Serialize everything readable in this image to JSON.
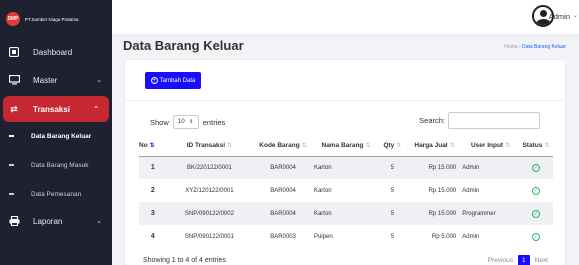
{
  "brand": {
    "logo_text": "SMP",
    "name": "PT.Sumber Niaga Pratama"
  },
  "sidebar": {
    "items": [
      {
        "label": "Dashboard",
        "icon": "dashboard-icon"
      },
      {
        "label": "Master",
        "icon": "monitor-icon"
      },
      {
        "label": "Transaksi",
        "icon": "exchange-icon"
      },
      {
        "label": "Laporan",
        "icon": "printer-icon"
      }
    ],
    "sub_items": [
      {
        "label": "Data Barang Keluar"
      },
      {
        "label": "Data Barang Masuk"
      },
      {
        "label": "Data Pemesanan"
      }
    ]
  },
  "topbar": {
    "user_label": "Admin"
  },
  "page": {
    "title": "Data Barang Keluar",
    "breadcrumb": {
      "home": "Home",
      "sep": "›",
      "current": "Data Barang Keluar"
    }
  },
  "toolbar": {
    "add_label": "Tambah Data"
  },
  "table_controls": {
    "show_label": "Show",
    "entries_value": "10",
    "entries_label": "entries",
    "search_label": "Search:"
  },
  "table": {
    "headers": [
      "No",
      "ID Transaksi",
      "Kode Barang",
      "Nama Barang",
      "Qty",
      "Harga Jual",
      "User Input",
      "Status"
    ],
    "rows": [
      {
        "no": "1",
        "id": "BK/220122/0001",
        "kode": "BAR0004",
        "nama": "Karton",
        "qty": "5",
        "harga": "Rp 15.000",
        "user": "Admin"
      },
      {
        "no": "2",
        "id": "XYZ/120122/0001",
        "kode": "BAR0004",
        "nama": "Karton",
        "qty": "5",
        "harga": "Rp 15.000",
        "user": "Admin"
      },
      {
        "no": "3",
        "id": "SNP/090122/0002",
        "kode": "BAR0004",
        "nama": "Karton",
        "qty": "5",
        "harga": "Rp 15.000",
        "user": "Programmer"
      },
      {
        "no": "4",
        "id": "SNP/090122/0001",
        "kode": "BAR0003",
        "nama": "Pulpen",
        "qty": "5",
        "harga": "Rp 5.000",
        "user": "Admin"
      }
    ]
  },
  "footer": {
    "info": "Showing 1 to 4 of 4 entries",
    "previous": "Previous",
    "current_page": "1",
    "next": "Next"
  },
  "colors": {
    "sidebar_bg": "#1e2230",
    "active_red": "#c62833",
    "primary_blue": "#1a0dff",
    "status_green": "#2fb36d"
  }
}
